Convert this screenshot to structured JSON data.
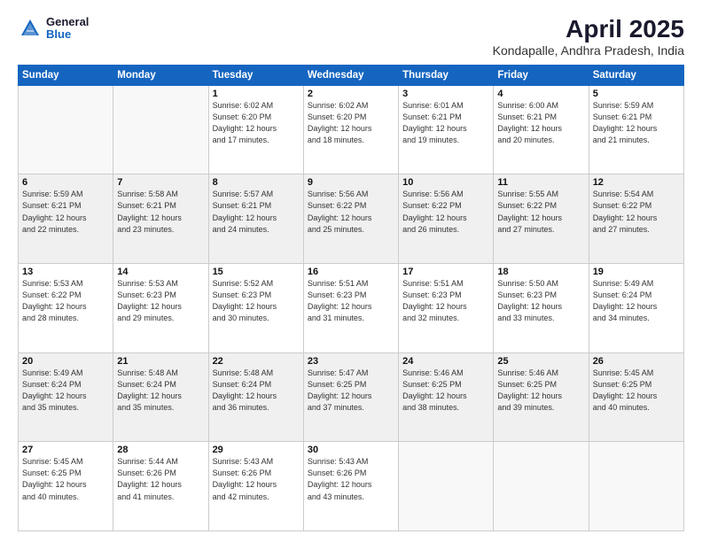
{
  "header": {
    "logo_general": "General",
    "logo_blue": "Blue",
    "title": "April 2025",
    "subtitle": "Kondapalle, Andhra Pradesh, India"
  },
  "days_of_week": [
    "Sunday",
    "Monday",
    "Tuesday",
    "Wednesday",
    "Thursday",
    "Friday",
    "Saturday"
  ],
  "weeks": [
    [
      {
        "day": "",
        "info": ""
      },
      {
        "day": "",
        "info": ""
      },
      {
        "day": "1",
        "info": "Sunrise: 6:02 AM\nSunset: 6:20 PM\nDaylight: 12 hours\nand 17 minutes."
      },
      {
        "day": "2",
        "info": "Sunrise: 6:02 AM\nSunset: 6:20 PM\nDaylight: 12 hours\nand 18 minutes."
      },
      {
        "day": "3",
        "info": "Sunrise: 6:01 AM\nSunset: 6:21 PM\nDaylight: 12 hours\nand 19 minutes."
      },
      {
        "day": "4",
        "info": "Sunrise: 6:00 AM\nSunset: 6:21 PM\nDaylight: 12 hours\nand 20 minutes."
      },
      {
        "day": "5",
        "info": "Sunrise: 5:59 AM\nSunset: 6:21 PM\nDaylight: 12 hours\nand 21 minutes."
      }
    ],
    [
      {
        "day": "6",
        "info": "Sunrise: 5:59 AM\nSunset: 6:21 PM\nDaylight: 12 hours\nand 22 minutes."
      },
      {
        "day": "7",
        "info": "Sunrise: 5:58 AM\nSunset: 6:21 PM\nDaylight: 12 hours\nand 23 minutes."
      },
      {
        "day": "8",
        "info": "Sunrise: 5:57 AM\nSunset: 6:21 PM\nDaylight: 12 hours\nand 24 minutes."
      },
      {
        "day": "9",
        "info": "Sunrise: 5:56 AM\nSunset: 6:22 PM\nDaylight: 12 hours\nand 25 minutes."
      },
      {
        "day": "10",
        "info": "Sunrise: 5:56 AM\nSunset: 6:22 PM\nDaylight: 12 hours\nand 26 minutes."
      },
      {
        "day": "11",
        "info": "Sunrise: 5:55 AM\nSunset: 6:22 PM\nDaylight: 12 hours\nand 27 minutes."
      },
      {
        "day": "12",
        "info": "Sunrise: 5:54 AM\nSunset: 6:22 PM\nDaylight: 12 hours\nand 27 minutes."
      }
    ],
    [
      {
        "day": "13",
        "info": "Sunrise: 5:53 AM\nSunset: 6:22 PM\nDaylight: 12 hours\nand 28 minutes."
      },
      {
        "day": "14",
        "info": "Sunrise: 5:53 AM\nSunset: 6:23 PM\nDaylight: 12 hours\nand 29 minutes."
      },
      {
        "day": "15",
        "info": "Sunrise: 5:52 AM\nSunset: 6:23 PM\nDaylight: 12 hours\nand 30 minutes."
      },
      {
        "day": "16",
        "info": "Sunrise: 5:51 AM\nSunset: 6:23 PM\nDaylight: 12 hours\nand 31 minutes."
      },
      {
        "day": "17",
        "info": "Sunrise: 5:51 AM\nSunset: 6:23 PM\nDaylight: 12 hours\nand 32 minutes."
      },
      {
        "day": "18",
        "info": "Sunrise: 5:50 AM\nSunset: 6:23 PM\nDaylight: 12 hours\nand 33 minutes."
      },
      {
        "day": "19",
        "info": "Sunrise: 5:49 AM\nSunset: 6:24 PM\nDaylight: 12 hours\nand 34 minutes."
      }
    ],
    [
      {
        "day": "20",
        "info": "Sunrise: 5:49 AM\nSunset: 6:24 PM\nDaylight: 12 hours\nand 35 minutes."
      },
      {
        "day": "21",
        "info": "Sunrise: 5:48 AM\nSunset: 6:24 PM\nDaylight: 12 hours\nand 35 minutes."
      },
      {
        "day": "22",
        "info": "Sunrise: 5:48 AM\nSunset: 6:24 PM\nDaylight: 12 hours\nand 36 minutes."
      },
      {
        "day": "23",
        "info": "Sunrise: 5:47 AM\nSunset: 6:25 PM\nDaylight: 12 hours\nand 37 minutes."
      },
      {
        "day": "24",
        "info": "Sunrise: 5:46 AM\nSunset: 6:25 PM\nDaylight: 12 hours\nand 38 minutes."
      },
      {
        "day": "25",
        "info": "Sunrise: 5:46 AM\nSunset: 6:25 PM\nDaylight: 12 hours\nand 39 minutes."
      },
      {
        "day": "26",
        "info": "Sunrise: 5:45 AM\nSunset: 6:25 PM\nDaylight: 12 hours\nand 40 minutes."
      }
    ],
    [
      {
        "day": "27",
        "info": "Sunrise: 5:45 AM\nSunset: 6:25 PM\nDaylight: 12 hours\nand 40 minutes."
      },
      {
        "day": "28",
        "info": "Sunrise: 5:44 AM\nSunset: 6:26 PM\nDaylight: 12 hours\nand 41 minutes."
      },
      {
        "day": "29",
        "info": "Sunrise: 5:43 AM\nSunset: 6:26 PM\nDaylight: 12 hours\nand 42 minutes."
      },
      {
        "day": "30",
        "info": "Sunrise: 5:43 AM\nSunset: 6:26 PM\nDaylight: 12 hours\nand 43 minutes."
      },
      {
        "day": "",
        "info": ""
      },
      {
        "day": "",
        "info": ""
      },
      {
        "day": "",
        "info": ""
      }
    ]
  ]
}
